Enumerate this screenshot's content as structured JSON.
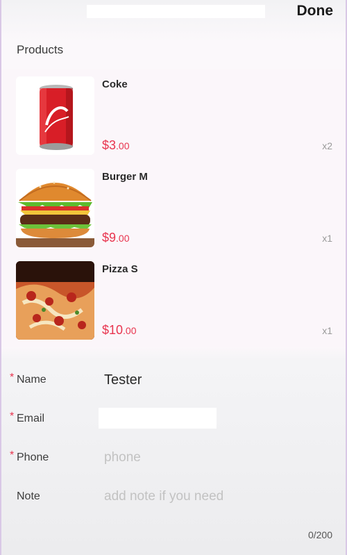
{
  "header": {
    "done_label": "Done"
  },
  "products": {
    "title": "Products",
    "items": [
      {
        "name": "Coke",
        "price_main": "$3",
        "price_cents": ".00",
        "qty": "x2",
        "image": "coke-can-image"
      },
      {
        "name": "Burger M",
        "price_main": "$9",
        "price_cents": ".00",
        "qty": "x1",
        "image": "burger-image"
      },
      {
        "name": "Pizza S",
        "price_main": "$10",
        "price_cents": ".00",
        "qty": "x1",
        "image": "pizza-image"
      }
    ]
  },
  "form": {
    "name": {
      "label": "Name",
      "value": "Tester",
      "required": "*"
    },
    "email": {
      "label": "Email",
      "value": "",
      "required": "*"
    },
    "phone": {
      "label": "Phone",
      "placeholder": "phone",
      "required": "*"
    },
    "note": {
      "label": "Note",
      "placeholder": "add note if you need"
    },
    "note_counter": "0/200"
  },
  "colors": {
    "accent_price": "#e8344e",
    "required_mark": "#e8344e"
  }
}
